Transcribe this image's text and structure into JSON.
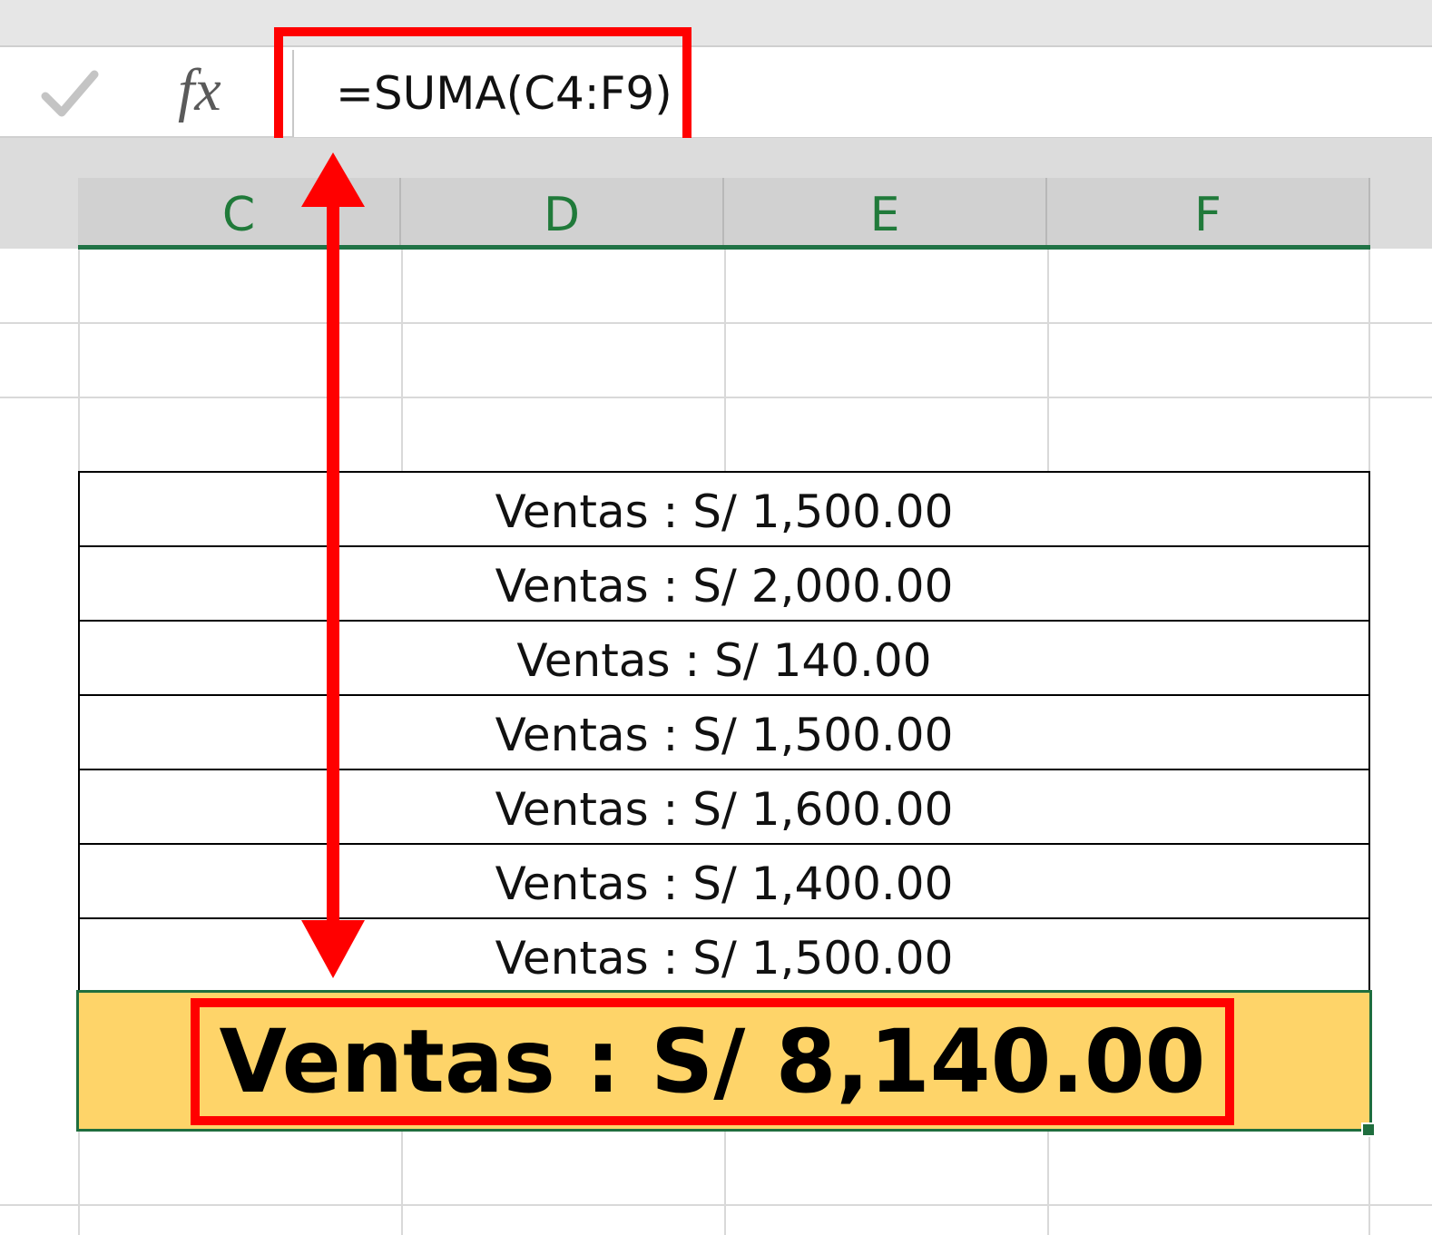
{
  "formula_bar": {
    "formula": "=SUMA(C4:F9)",
    "fx_label": "fx"
  },
  "columns": [
    "C",
    "D",
    "E",
    "F"
  ],
  "rows": [
    "Ventas : S/ 1,500.00",
    "Ventas : S/ 2,000.00",
    "Ventas : S/ 140.00",
    "Ventas : S/ 1,500.00",
    "Ventas : S/ 1,600.00",
    "Ventas : S/ 1,400.00",
    "Ventas : S/ 1,500.00"
  ],
  "total": "Ventas : S/ 8,140.00",
  "colors": {
    "highlight": "#ff0000",
    "total_fill": "#fed469",
    "header_text": "#207a3a"
  },
  "icons": [
    "check-icon",
    "fx-icon"
  ]
}
